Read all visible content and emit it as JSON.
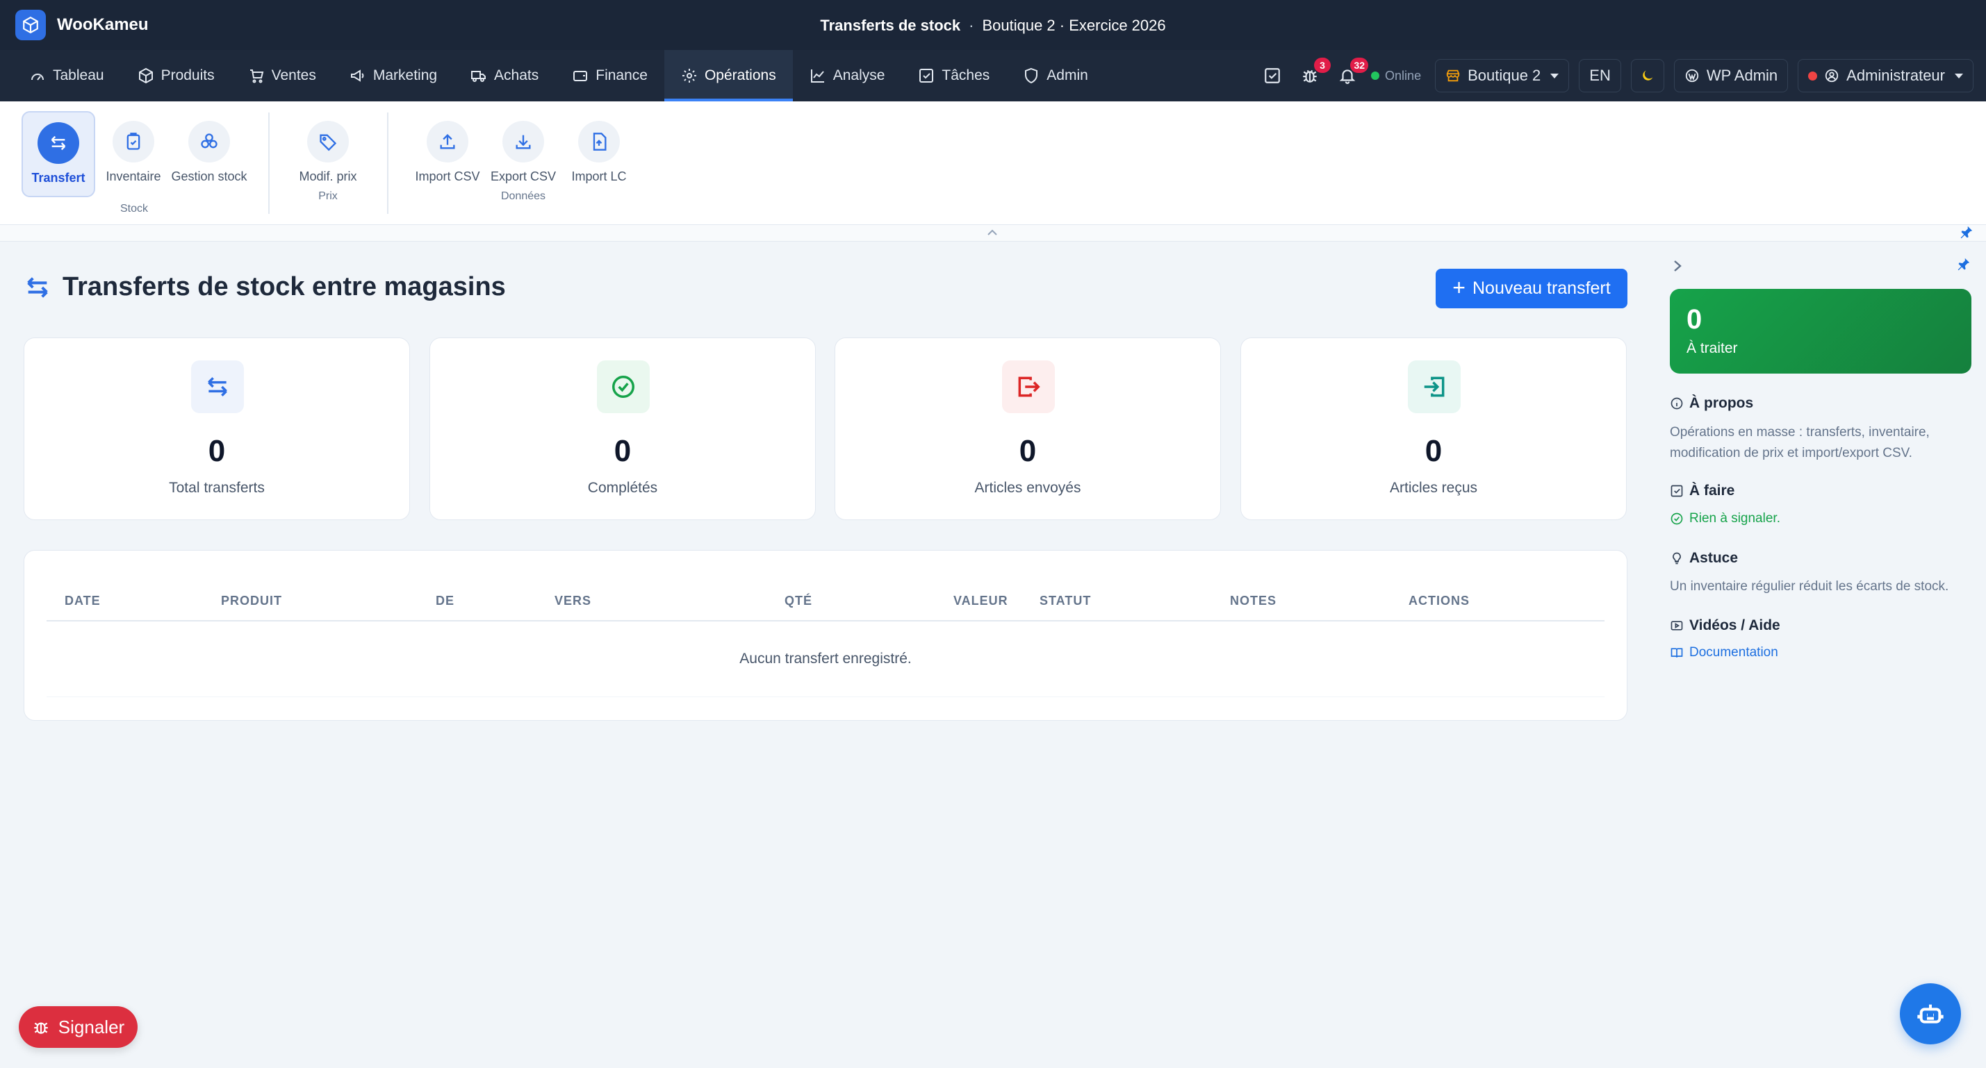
{
  "app": {
    "name": "WooKameu"
  },
  "window_title": {
    "page": "Transferts de stock",
    "separator": "·",
    "context": "Boutique 2 · Exercice 2026"
  },
  "nav": {
    "items": [
      {
        "label": "Tableau",
        "icon": "gauge-icon"
      },
      {
        "label": "Produits",
        "icon": "box-icon"
      },
      {
        "label": "Ventes",
        "icon": "cart-icon"
      },
      {
        "label": "Marketing",
        "icon": "megaphone-icon"
      },
      {
        "label": "Achats",
        "icon": "truck-icon"
      },
      {
        "label": "Finance",
        "icon": "wallet-icon"
      },
      {
        "label": "Opérations",
        "icon": "gear-icon",
        "active": true
      },
      {
        "label": "Analyse",
        "icon": "chart-line-icon"
      },
      {
        "label": "Tâches",
        "icon": "checkbox-icon"
      },
      {
        "label": "Admin",
        "icon": "shield-icon"
      }
    ],
    "bug_badge": "3",
    "bell_badge": "32",
    "online_label": "Online",
    "store_label": "Boutique 2",
    "lang": "EN",
    "wp_admin": "WP Admin",
    "user": "Administrateur"
  },
  "ribbon": {
    "tools": [
      {
        "label": "Transfert",
        "active": true
      },
      {
        "label": "Inventaire"
      },
      {
        "label": "Gestion stock"
      },
      {
        "label": "Modif. prix"
      },
      {
        "label": "Import CSV"
      },
      {
        "label": "Export CSV"
      },
      {
        "label": "Import LC"
      }
    ],
    "groups": {
      "stock": "Stock",
      "prix": "Prix",
      "donnees": "Données"
    }
  },
  "page": {
    "title": "Transferts de stock entre magasins",
    "new_button": "Nouveau transfert"
  },
  "stats": [
    {
      "value": "0",
      "label": "Total transferts",
      "color": "#2f6fe4"
    },
    {
      "value": "0",
      "label": "Complétés",
      "color": "#16a34a"
    },
    {
      "value": "0",
      "label": "Articles envoyés",
      "color": "#dc2626"
    },
    {
      "value": "0",
      "label": "Articles reçus",
      "color": "#0d9488"
    }
  ],
  "table": {
    "columns": [
      "DATE",
      "PRODUIT",
      "DE",
      "VERS",
      "QTÉ",
      "VALEUR",
      "STATUT",
      "NOTES",
      "ACTIONS"
    ],
    "empty_message": "Aucun transfert enregistré."
  },
  "side": {
    "todo_count": "0",
    "todo_label": "À traiter",
    "about_title": "À propos",
    "about_text": "Opérations en masse : transferts, inventaire, modification de prix et import/export CSV.",
    "todo_title": "À faire",
    "todo_ok": "Rien à signaler.",
    "tip_title": "Astuce",
    "tip_text": "Un inventaire régulier réduit les écarts de stock.",
    "videos_title": "Vidéos / Aide",
    "doc_link": "Documentation"
  },
  "floating": {
    "report_label": "Signaler"
  }
}
